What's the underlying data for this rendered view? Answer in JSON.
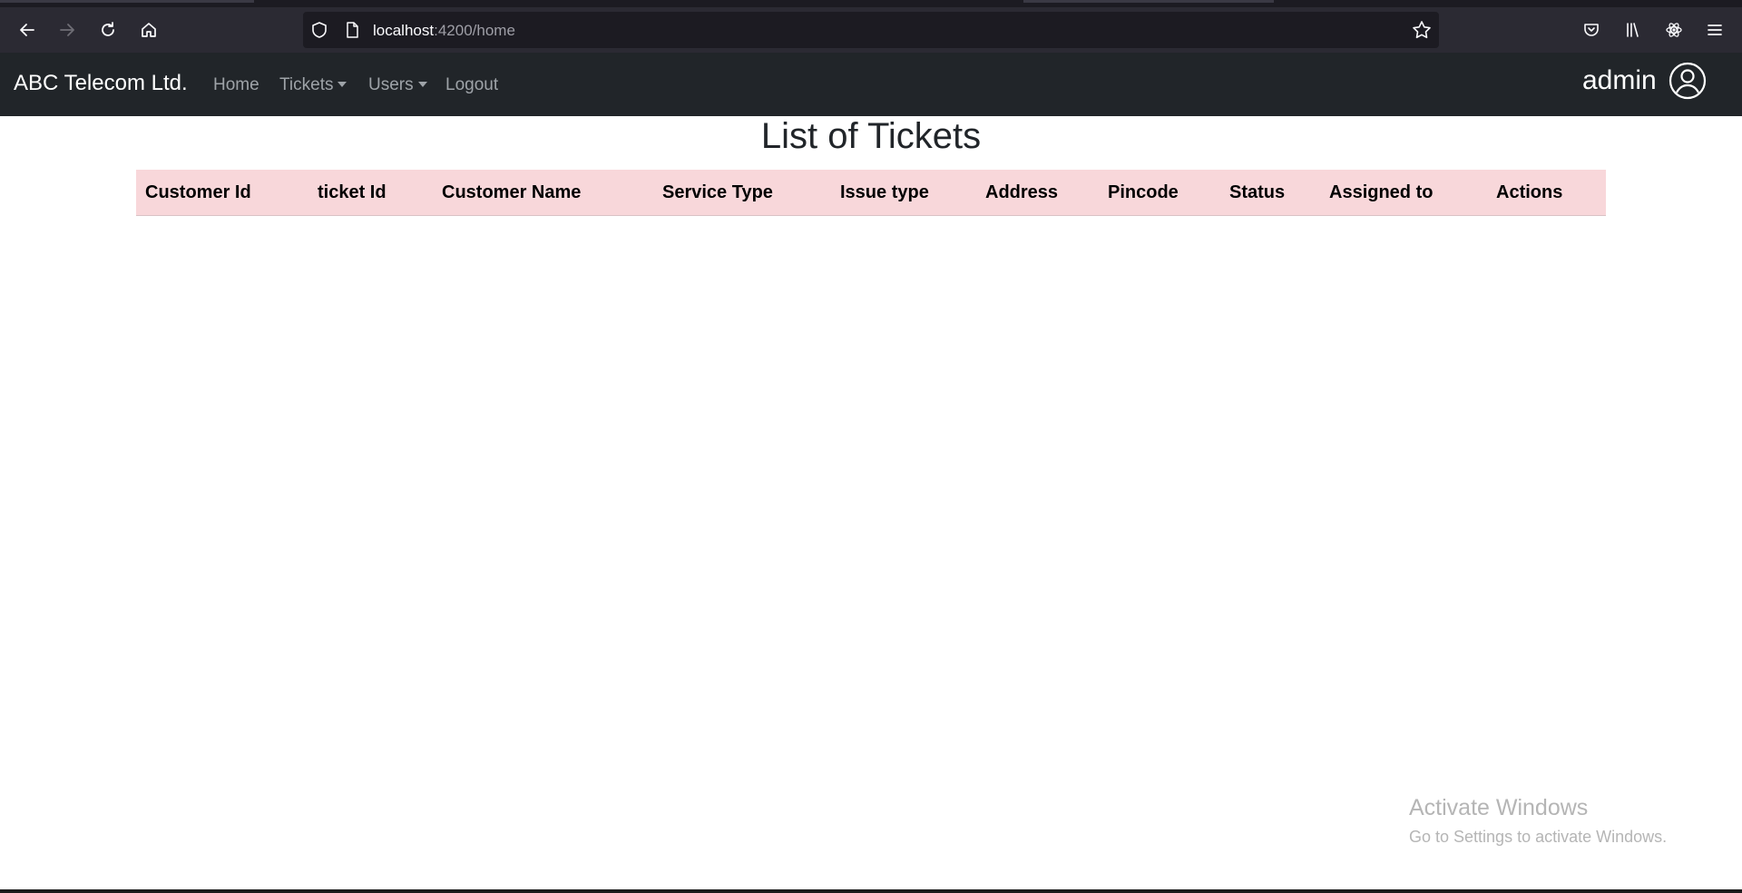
{
  "browser": {
    "url_host": "localhost",
    "url_rest": ":4200/home"
  },
  "navbar": {
    "brand": "ABC Telecom Ltd.",
    "items": [
      {
        "label": "Home"
      },
      {
        "label": "Tickets"
      },
      {
        "label": "Users"
      },
      {
        "label": "Logout"
      }
    ],
    "user": "admin"
  },
  "main": {
    "title": "List of Tickets",
    "columns": [
      "Customer Id",
      "ticket Id",
      "Customer Name",
      "Service Type",
      "Issue type",
      "Address",
      "Pincode",
      "Status",
      "Assigned to",
      "Actions"
    ],
    "rows": []
  },
  "watermark": {
    "title": "Activate Windows",
    "subtitle": "Go to Settings to activate Windows."
  },
  "colors": {
    "navbar_bg": "#212529",
    "table_header_bg": "#f8d7da",
    "browser_toolbar": "#2b2a33"
  }
}
